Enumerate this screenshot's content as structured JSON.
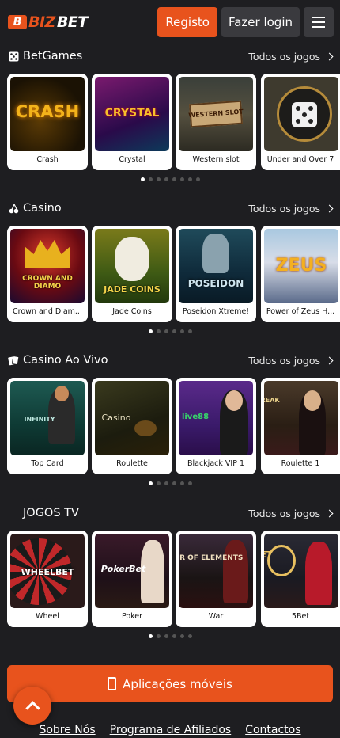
{
  "header": {
    "logo_mark": "B",
    "logo_biz": "BIZ",
    "logo_bet": "BET",
    "register_label": "Registo",
    "login_label": "Fazer login",
    "menu_icon": "hamburger-icon"
  },
  "sections": [
    {
      "title": "BetGames",
      "icon": "dice-icon",
      "all_label": "Todos os jogos",
      "games": [
        "Crash",
        "Crystal",
        "Western slot",
        "Under and Over 7"
      ],
      "art": [
        "CRASH",
        "CRYSTAL",
        "WESTERN SLOT",
        ""
      ],
      "dots": 8,
      "active_dot": 0
    },
    {
      "title": "Casino",
      "icon": "cherries-icon",
      "all_label": "Todos os jogos",
      "games": [
        "Crown and Diam...",
        "Jade Coins",
        "Poseidon Xtreme!",
        "Power of Zeus H..."
      ],
      "art": [
        "CROWN AND DIAMO",
        "JADE COINS",
        "POSEIDON",
        "ZEUS"
      ],
      "dots": 6,
      "active_dot": 0
    },
    {
      "title": "Casino Ao Vivo",
      "icon": "cards-icon",
      "all_label": "Todos os jogos",
      "games": [
        "Top Card",
        "Roulette",
        "Blackjack VIP 1",
        "Roulette 1"
      ],
      "art": [
        "INFINITY",
        "Casino",
        "live88",
        "LUCKY STREAK"
      ],
      "dots": 6,
      "active_dot": 0
    },
    {
      "title": "JOGOS TV",
      "icon": "",
      "all_label": "Todos os jogos",
      "games": [
        "Wheel",
        "Poker",
        "War",
        "5Bet"
      ],
      "art": [
        "WHEELBET",
        "PokerBet",
        "WAR OF ELEMENTS",
        "5 BET"
      ],
      "dots": 6,
      "active_dot": 0
    }
  ],
  "apps_button": {
    "label": "Aplicações móveis",
    "icon": "smartphone-icon"
  },
  "scroll_top": {
    "icon": "chevron-up-icon"
  },
  "footer": {
    "links": [
      "Sobre Nós",
      "Programa de Afiliados",
      "Contactos"
    ]
  },
  "colors": {
    "accent": "#e8531d",
    "background": "#1e1e21",
    "secondary_button": "#3a3a3e"
  }
}
